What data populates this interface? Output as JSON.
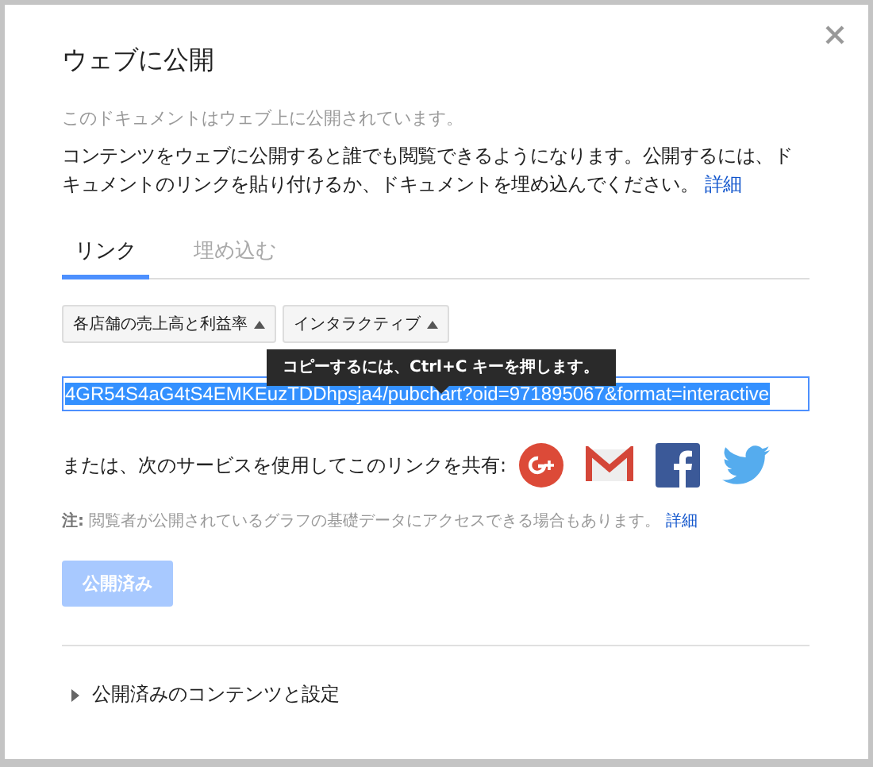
{
  "dialog": {
    "title": "ウェブに公開",
    "status": "このドキュメントはウェブ上に公開されています。",
    "description": {
      "text": "コンテンツをウェブに公開すると誰でも閲覧できるようになります。公開するには、ドキュメントのリンクを貼り付けるか、ドキュメントを埋め込んでください。",
      "link": "詳細"
    }
  },
  "tabs": [
    {
      "label": "リンク",
      "selected": true
    },
    {
      "label": "埋め込む",
      "selected": false
    }
  ],
  "dropdowns": [
    {
      "label": "各店舗の売上高と利益率"
    },
    {
      "label": "インタラクティブ"
    }
  ],
  "tooltip": "コピーするには、Ctrl+C キーを押します。",
  "link_field": {
    "value": "4GR54S4aG4tS4EMKEuzTDDhpsja4/pubchart?oid=971895067&format=interactive",
    "text_selected": true
  },
  "share": {
    "label": "または、次のサービスを使用してこのリンクを共有:",
    "services": [
      {
        "kind": "gplus"
      },
      {
        "kind": "gmail"
      },
      {
        "kind": "facebook"
      },
      {
        "kind": "twitter"
      }
    ]
  },
  "note": {
    "text": "**注:** 閲覧者が公開されているグラフの基礎データにアクセスできる場合もあります。",
    "link": "詳細"
  },
  "publish_button": {
    "label": "公開済み",
    "disabled": true
  },
  "section": {
    "label": "公開済みのコンテンツと設定",
    "expanded": false
  }
}
